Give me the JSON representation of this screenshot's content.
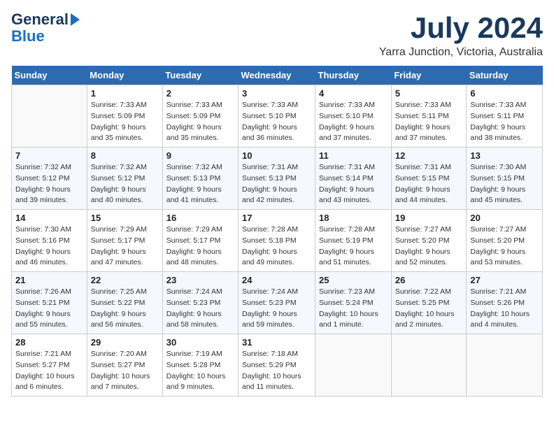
{
  "logo": {
    "line1": "General",
    "line2": "Blue",
    "arrow": "▶"
  },
  "title": "July 2024",
  "location": "Yarra Junction, Victoria, Australia",
  "days_of_week": [
    "Sunday",
    "Monday",
    "Tuesday",
    "Wednesday",
    "Thursday",
    "Friday",
    "Saturday"
  ],
  "weeks": [
    [
      {
        "day": "",
        "sunrise": "",
        "sunset": "",
        "daylight": ""
      },
      {
        "day": "1",
        "sunrise": "Sunrise: 7:33 AM",
        "sunset": "Sunset: 5:09 PM",
        "daylight": "Daylight: 9 hours and 35 minutes."
      },
      {
        "day": "2",
        "sunrise": "Sunrise: 7:33 AM",
        "sunset": "Sunset: 5:09 PM",
        "daylight": "Daylight: 9 hours and 35 minutes."
      },
      {
        "day": "3",
        "sunrise": "Sunrise: 7:33 AM",
        "sunset": "Sunset: 5:10 PM",
        "daylight": "Daylight: 9 hours and 36 minutes."
      },
      {
        "day": "4",
        "sunrise": "Sunrise: 7:33 AM",
        "sunset": "Sunset: 5:10 PM",
        "daylight": "Daylight: 9 hours and 37 minutes."
      },
      {
        "day": "5",
        "sunrise": "Sunrise: 7:33 AM",
        "sunset": "Sunset: 5:11 PM",
        "daylight": "Daylight: 9 hours and 37 minutes."
      },
      {
        "day": "6",
        "sunrise": "Sunrise: 7:33 AM",
        "sunset": "Sunset: 5:11 PM",
        "daylight": "Daylight: 9 hours and 38 minutes."
      }
    ],
    [
      {
        "day": "7",
        "sunrise": "Sunrise: 7:32 AM",
        "sunset": "Sunset: 5:12 PM",
        "daylight": "Daylight: 9 hours and 39 minutes."
      },
      {
        "day": "8",
        "sunrise": "Sunrise: 7:32 AM",
        "sunset": "Sunset: 5:12 PM",
        "daylight": "Daylight: 9 hours and 40 minutes."
      },
      {
        "day": "9",
        "sunrise": "Sunrise: 7:32 AM",
        "sunset": "Sunset: 5:13 PM",
        "daylight": "Daylight: 9 hours and 41 minutes."
      },
      {
        "day": "10",
        "sunrise": "Sunrise: 7:31 AM",
        "sunset": "Sunset: 5:13 PM",
        "daylight": "Daylight: 9 hours and 42 minutes."
      },
      {
        "day": "11",
        "sunrise": "Sunrise: 7:31 AM",
        "sunset": "Sunset: 5:14 PM",
        "daylight": "Daylight: 9 hours and 43 minutes."
      },
      {
        "day": "12",
        "sunrise": "Sunrise: 7:31 AM",
        "sunset": "Sunset: 5:15 PM",
        "daylight": "Daylight: 9 hours and 44 minutes."
      },
      {
        "day": "13",
        "sunrise": "Sunrise: 7:30 AM",
        "sunset": "Sunset: 5:15 PM",
        "daylight": "Daylight: 9 hours and 45 minutes."
      }
    ],
    [
      {
        "day": "14",
        "sunrise": "Sunrise: 7:30 AM",
        "sunset": "Sunset: 5:16 PM",
        "daylight": "Daylight: 9 hours and 46 minutes."
      },
      {
        "day": "15",
        "sunrise": "Sunrise: 7:29 AM",
        "sunset": "Sunset: 5:17 PM",
        "daylight": "Daylight: 9 hours and 47 minutes."
      },
      {
        "day": "16",
        "sunrise": "Sunrise: 7:29 AM",
        "sunset": "Sunset: 5:17 PM",
        "daylight": "Daylight: 9 hours and 48 minutes."
      },
      {
        "day": "17",
        "sunrise": "Sunrise: 7:28 AM",
        "sunset": "Sunset: 5:18 PM",
        "daylight": "Daylight: 9 hours and 49 minutes."
      },
      {
        "day": "18",
        "sunrise": "Sunrise: 7:28 AM",
        "sunset": "Sunset: 5:19 PM",
        "daylight": "Daylight: 9 hours and 51 minutes."
      },
      {
        "day": "19",
        "sunrise": "Sunrise: 7:27 AM",
        "sunset": "Sunset: 5:20 PM",
        "daylight": "Daylight: 9 hours and 52 minutes."
      },
      {
        "day": "20",
        "sunrise": "Sunrise: 7:27 AM",
        "sunset": "Sunset: 5:20 PM",
        "daylight": "Daylight: 9 hours and 53 minutes."
      }
    ],
    [
      {
        "day": "21",
        "sunrise": "Sunrise: 7:26 AM",
        "sunset": "Sunset: 5:21 PM",
        "daylight": "Daylight: 9 hours and 55 minutes."
      },
      {
        "day": "22",
        "sunrise": "Sunrise: 7:25 AM",
        "sunset": "Sunset: 5:22 PM",
        "daylight": "Daylight: 9 hours and 56 minutes."
      },
      {
        "day": "23",
        "sunrise": "Sunrise: 7:24 AM",
        "sunset": "Sunset: 5:23 PM",
        "daylight": "Daylight: 9 hours and 58 minutes."
      },
      {
        "day": "24",
        "sunrise": "Sunrise: 7:24 AM",
        "sunset": "Sunset: 5:23 PM",
        "daylight": "Daylight: 9 hours and 59 minutes."
      },
      {
        "day": "25",
        "sunrise": "Sunrise: 7:23 AM",
        "sunset": "Sunset: 5:24 PM",
        "daylight": "Daylight: 10 hours and 1 minute."
      },
      {
        "day": "26",
        "sunrise": "Sunrise: 7:22 AM",
        "sunset": "Sunset: 5:25 PM",
        "daylight": "Daylight: 10 hours and 2 minutes."
      },
      {
        "day": "27",
        "sunrise": "Sunrise: 7:21 AM",
        "sunset": "Sunset: 5:26 PM",
        "daylight": "Daylight: 10 hours and 4 minutes."
      }
    ],
    [
      {
        "day": "28",
        "sunrise": "Sunrise: 7:21 AM",
        "sunset": "Sunset: 5:27 PM",
        "daylight": "Daylight: 10 hours and 6 minutes."
      },
      {
        "day": "29",
        "sunrise": "Sunrise: 7:20 AM",
        "sunset": "Sunset: 5:27 PM",
        "daylight": "Daylight: 10 hours and 7 minutes."
      },
      {
        "day": "30",
        "sunrise": "Sunrise: 7:19 AM",
        "sunset": "Sunset: 5:28 PM",
        "daylight": "Daylight: 10 hours and 9 minutes."
      },
      {
        "day": "31",
        "sunrise": "Sunrise: 7:18 AM",
        "sunset": "Sunset: 5:29 PM",
        "daylight": "Daylight: 10 hours and 11 minutes."
      },
      {
        "day": "",
        "sunrise": "",
        "sunset": "",
        "daylight": ""
      },
      {
        "day": "",
        "sunrise": "",
        "sunset": "",
        "daylight": ""
      },
      {
        "day": "",
        "sunrise": "",
        "sunset": "",
        "daylight": ""
      }
    ]
  ]
}
